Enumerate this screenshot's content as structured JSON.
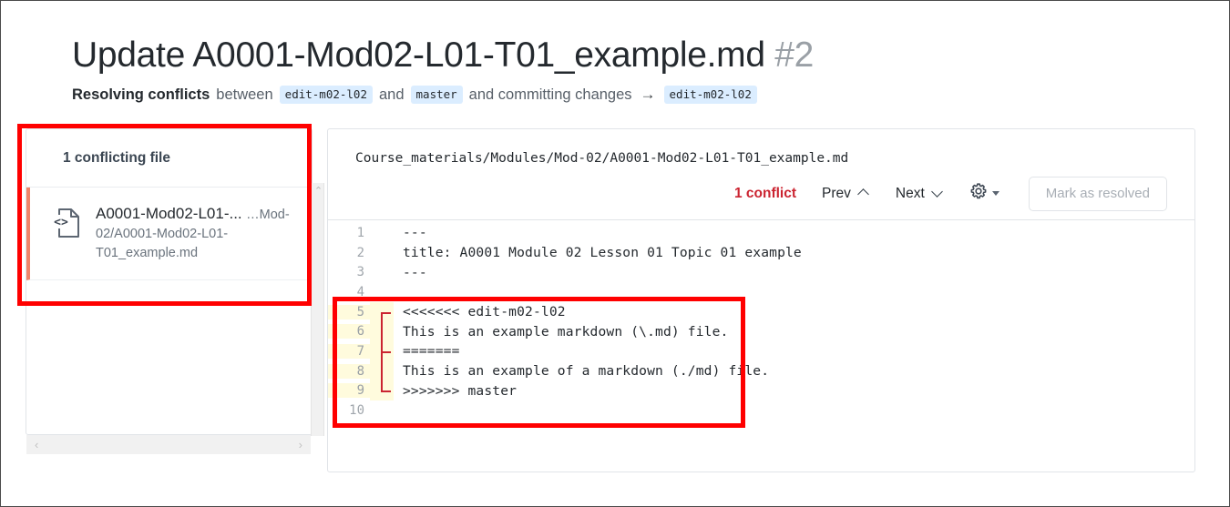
{
  "header": {
    "title": "Update A0001-Mod02-L01-T01_example.md",
    "number": "#2",
    "subtitle_strong": "Resolving conflicts",
    "subtitle_between": "between",
    "branch_source": "edit-m02-l02",
    "subtitle_and": "and",
    "branch_target": "master",
    "subtitle_commit": "and committing changes",
    "arrow": "→",
    "branch_commit_to": "edit-m02-l02"
  },
  "sidebar": {
    "heading": "1 conflicting file",
    "file_icon": "code-file-icon",
    "file_name": "A0001-Mod02-L01-...",
    "file_path": "…Mod-02/A0001-Mod02-L01-T01_example.md",
    "vscroll_up": "⌃",
    "hscroll_left": "‹",
    "hscroll_right": "›"
  },
  "editor": {
    "file_fullpath": "Course_materials/Modules/Mod-02/A0001-Mod02-L01-T01_example.md",
    "conflict_count": "1 conflict",
    "prev_label": "Prev",
    "next_label": "Next",
    "settings_icon": "gear-icon",
    "mark_resolved_label": "Mark as resolved",
    "accent_red": "#cb2431",
    "conflict_highlight": "#fffbdd",
    "selected_file_accent": "#f0846a",
    "lines": [
      {
        "n": "1",
        "text": "---",
        "conflict": false,
        "marker": ""
      },
      {
        "n": "2",
        "text": "title: A0001 Module 02 Lesson 01 Topic 01 example",
        "conflict": false,
        "marker": ""
      },
      {
        "n": "3",
        "text": "---",
        "conflict": false,
        "marker": ""
      },
      {
        "n": "4",
        "text": "",
        "conflict": false,
        "marker": ""
      },
      {
        "n": "5",
        "text": "<<<<<<< edit-m02-l02",
        "conflict": true,
        "marker": "start"
      },
      {
        "n": "6",
        "text": "This is an example markdown (\\.md) file.",
        "conflict": true,
        "marker": "mid"
      },
      {
        "n": "7",
        "text": "=======",
        "conflict": true,
        "marker": "sep"
      },
      {
        "n": "8",
        "text": "This is an example of a markdown (./md) file.",
        "conflict": true,
        "marker": "mid"
      },
      {
        "n": "9",
        "text": ">>>>>>> master",
        "conflict": true,
        "marker": "end"
      },
      {
        "n": "10",
        "text": "",
        "conflict": false,
        "marker": ""
      }
    ]
  },
  "annotations": {
    "box_color": "#ff0000",
    "box_sidebar": "conflicting-file-list-highlight",
    "box_conflict": "conflict-block-highlight"
  }
}
